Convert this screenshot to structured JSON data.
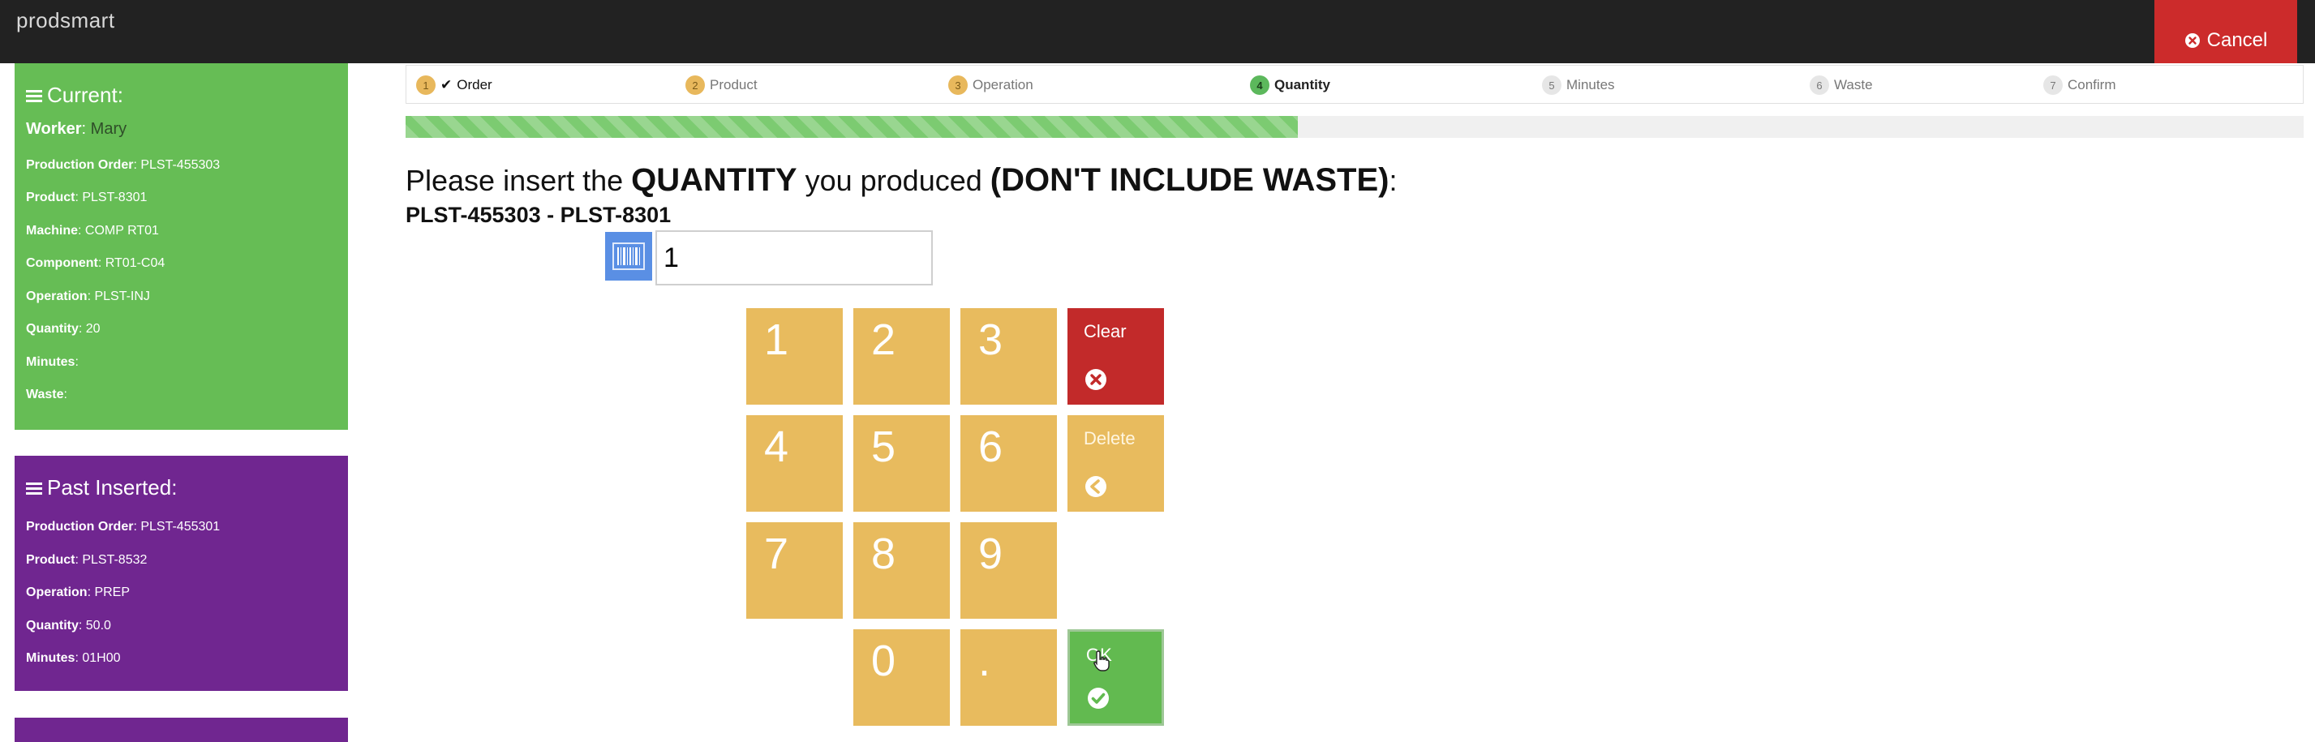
{
  "app": {
    "brand": "prodsmart"
  },
  "header": {
    "cancel_label": "Cancel"
  },
  "current": {
    "title": "Current:",
    "worker_label": "Worker",
    "worker_value": "Mary",
    "rows": [
      {
        "label": "Production Order",
        "value": "PLST-455303"
      },
      {
        "label": "Product",
        "value": "PLST-8301"
      },
      {
        "label": "Machine",
        "value": "COMP RT01"
      },
      {
        "label": "Component",
        "value": "RT01-C04"
      },
      {
        "label": "Operation",
        "value": "PLST-INJ"
      },
      {
        "label": "Quantity",
        "value": "20"
      },
      {
        "label": "Minutes",
        "value": ""
      },
      {
        "label": "Waste",
        "value": ""
      }
    ]
  },
  "past": {
    "title": "Past Inserted:",
    "rows": [
      {
        "label": "Production Order",
        "value": "PLST-455301"
      },
      {
        "label": "Product",
        "value": "PLST-8532"
      },
      {
        "label": "Operation",
        "value": "PREP"
      },
      {
        "label": "Quantity",
        "value": "50.0"
      },
      {
        "label": "Minutes",
        "value": "01H00"
      }
    ]
  },
  "steps": [
    {
      "num": "1",
      "label": "Order",
      "state": "done",
      "check": "✔"
    },
    {
      "num": "2",
      "label": "Product",
      "state": "done"
    },
    {
      "num": "3",
      "label": "Operation",
      "state": "done"
    },
    {
      "num": "4",
      "label": "Quantity",
      "state": "active"
    },
    {
      "num": "5",
      "label": "Minutes",
      "state": "pending"
    },
    {
      "num": "6",
      "label": "Waste",
      "state": "pending"
    },
    {
      "num": "7",
      "label": "Confirm",
      "state": "pending"
    }
  ],
  "progress": {
    "fraction": 0.47
  },
  "prompt": {
    "part1": "Please insert the ",
    "part2": "QUANTITY",
    "part3": " you produced ",
    "part4": "(DON'T INCLUDE WASTE)",
    "part5": ":"
  },
  "order_line": "PLST-455303 - PLST-8301",
  "input": {
    "value": "1"
  },
  "keypad": {
    "digits": [
      "1",
      "2",
      "3",
      "4",
      "5",
      "6",
      "7",
      "8",
      "9",
      "0",
      "."
    ],
    "clear_label": "Clear",
    "delete_label": "Delete",
    "ok_label": "OK"
  },
  "colors": {
    "accent_green": "#66bd55",
    "past_purple": "#702690",
    "key_orange": "#e8bb5e",
    "clear_red": "#c22a2a",
    "cancel_red": "#cc2b2b"
  }
}
